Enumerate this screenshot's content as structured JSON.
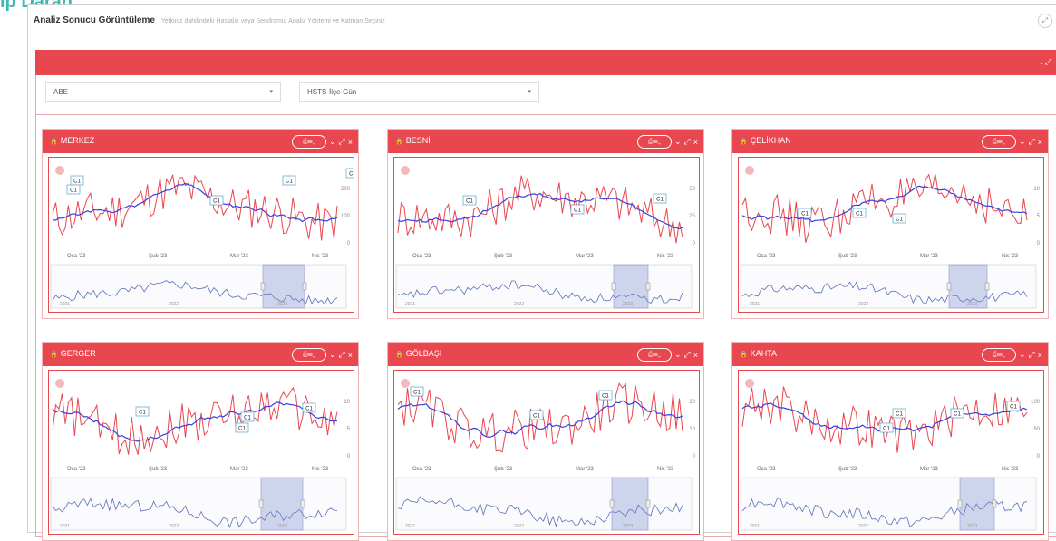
{
  "top_cut_text": "ip Daran",
  "header": {
    "title": "Analiz Sonucu Görüntüleme",
    "subtitle": "Yetkiniz dahilindeki Hastalık veya Sendromu, Analiz Yöntemi ve Katman Seçiniz"
  },
  "filters": {
    "region": "ABE",
    "layer": "HSTS-İlçe-Gün"
  },
  "panel_tools": {
    "pill_label": "⎙☰⌄",
    "collapse": "⌄",
    "expand": "⤢",
    "close": "×"
  },
  "x_ticks": [
    "Oca '23",
    "Şub '23",
    "Mar '23",
    "Nis '23"
  ],
  "annotation_label": "C1",
  "navigator_years": [
    "2021",
    "2022",
    "2023"
  ],
  "panels": [
    {
      "name": "MERKEZ",
      "y_ticks": [
        "200",
        "100",
        "0"
      ]
    },
    {
      "name": "BESNİ",
      "y_ticks": [
        "50",
        "25",
        "0"
      ]
    },
    {
      "name": "ÇELİKHAN",
      "y_ticks": [
        "10",
        "5",
        "0"
      ]
    },
    {
      "name": "GERGER",
      "y_ticks": [
        "10",
        "5",
        "0"
      ]
    },
    {
      "name": "GÖLBAŞI",
      "y_ticks": [
        "20",
        "10",
        "0"
      ]
    },
    {
      "name": "KAHTA",
      "y_ticks": [
        "100",
        "50",
        "0"
      ]
    }
  ]
}
